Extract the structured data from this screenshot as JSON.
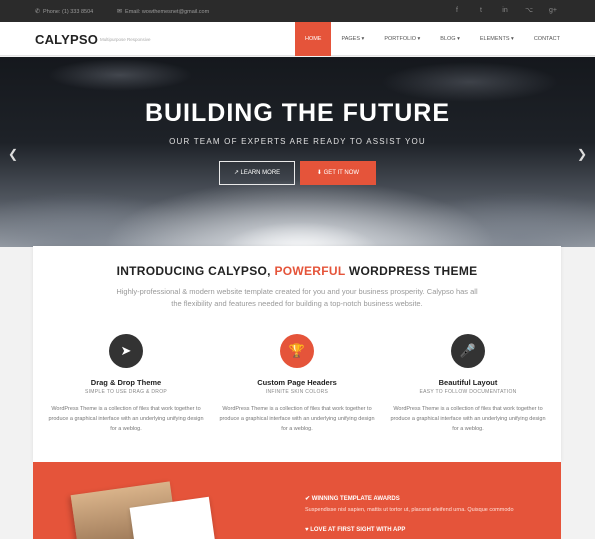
{
  "topbar": {
    "phone": "Phone: (1) 333 8504",
    "email": "Email: wowthemesnet@gmail.com",
    "social": [
      {
        "icon": "facebook-icon",
        "glyph": "f"
      },
      {
        "icon": "twitter-icon",
        "glyph": "t"
      },
      {
        "icon": "linkedin-icon",
        "glyph": "in"
      },
      {
        "icon": "github-icon",
        "glyph": "⌥"
      },
      {
        "icon": "google-plus-icon",
        "glyph": "g+"
      }
    ]
  },
  "nav": {
    "logo": "CALYPSO",
    "tagline": "Multipurpose Responsive",
    "items": [
      {
        "label": "HOME",
        "active": true
      },
      {
        "label": "PAGES ▾"
      },
      {
        "label": "PORTFOLIO ▾"
      },
      {
        "label": "BLOG ▾"
      },
      {
        "label": "ELEMENTS ▾"
      },
      {
        "label": "CONTACT"
      }
    ]
  },
  "hero": {
    "title": "BUILDING THE FUTURE",
    "subtitle": "OUR TEAM OF EXPERTS ARE READY TO ASSIST YOU",
    "btn_learn": "↗ LEARN MORE",
    "btn_get": "⬇ GET IT NOW"
  },
  "intro": {
    "title_pre": "INTRODUCING CALYPSO, ",
    "title_hl": "POWERFUL",
    "title_post": " WORDPRESS THEME",
    "desc": "Highly-professional & modern website template created for you and your business prosperity. Calypso has all the flexibility and features needed for building a top-notch business website."
  },
  "features": [
    {
      "title": "Drag & Drop Theme",
      "sub": "SIMPLE TO USE DRAG & DROP",
      "icon": "paper-plane-icon",
      "glyph": "➤",
      "color": "#333333",
      "text": "WordPress Theme is a collection of files that work together to produce a graphical interface with an underlying unifying design for a weblog."
    },
    {
      "title": "Custom Page Headers",
      "sub": "INFINITE SKIN COLORS",
      "icon": "trophy-icon",
      "glyph": "🏆",
      "color": "#e5543a",
      "text": "WordPress Theme is a collection of files that work together to produce a graphical interface with an underlying unifying design for a weblog."
    },
    {
      "title": "Beautiful Layout",
      "sub": "EASY TO FOLLOW DOCUMENTATION",
      "icon": "microphone-icon",
      "glyph": "🎤",
      "color": "#333333",
      "text": "WordPress Theme is a collection of files that work together to produce a graphical interface with an underlying unifying design for a weblog."
    }
  ],
  "awards": {
    "item1": "✔ WINNING TEMPLATE AWARDS",
    "text1": "Suspendisse nisl sapien, mattis ut tortor ut, placerat eleifend urna. Quisque commodo",
    "item2": "♥ LOVE AT FIRST SIGHT WITH APP"
  },
  "colors": {
    "accent": "#e5543a",
    "dark": "#2b2b2b"
  }
}
